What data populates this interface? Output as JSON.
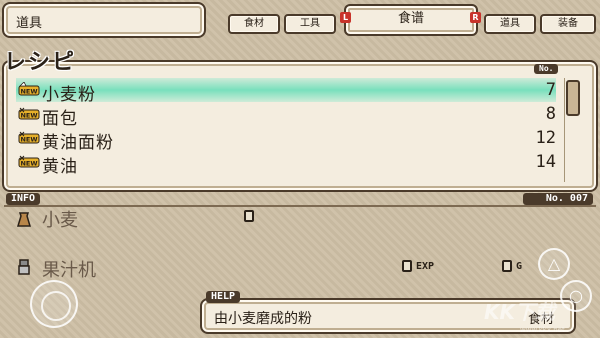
{
  "header": {
    "title": "道具",
    "tabs": [
      {
        "label": "食材"
      },
      {
        "label": "工具"
      },
      {
        "label": "食谱",
        "active": true
      },
      {
        "label": "道具"
      },
      {
        "label": "装备"
      }
    ],
    "shoulder_left": "L",
    "shoulder_right": "R"
  },
  "recipe_list": {
    "heading": "レシピ",
    "number_header": "No.",
    "new_badge": "NEW",
    "items": [
      {
        "name": "小麦粉",
        "number": "7",
        "selected": true,
        "is_new": true
      },
      {
        "name": "面包",
        "number": "8",
        "is_new": true
      },
      {
        "name": "黄油面粉",
        "number": "12",
        "is_new": true
      },
      {
        "name": "黄油",
        "number": "14",
        "is_new": true
      }
    ],
    "selection_color": "#5fdcb6"
  },
  "info": {
    "label": "INFO",
    "code": "No. 007",
    "ingredients": [
      {
        "name": "小麦",
        "icon": "sack-icon"
      },
      {
        "name": "果汁机",
        "icon": "tool-icon"
      }
    ],
    "exp_label": "EXP",
    "g_label": "G"
  },
  "help": {
    "label": "HELP",
    "text": "由小麦磨成的粉",
    "category": "食材"
  },
  "overlay": {
    "triangle": "△",
    "circle": "○",
    "watermark": "KK下载",
    "watermark_url": "www.kkx.net"
  },
  "colors": {
    "panel": "#f4eddf",
    "border": "#4a3a2a",
    "background": "#cdbfa5",
    "shoulder": "#c8332b"
  }
}
